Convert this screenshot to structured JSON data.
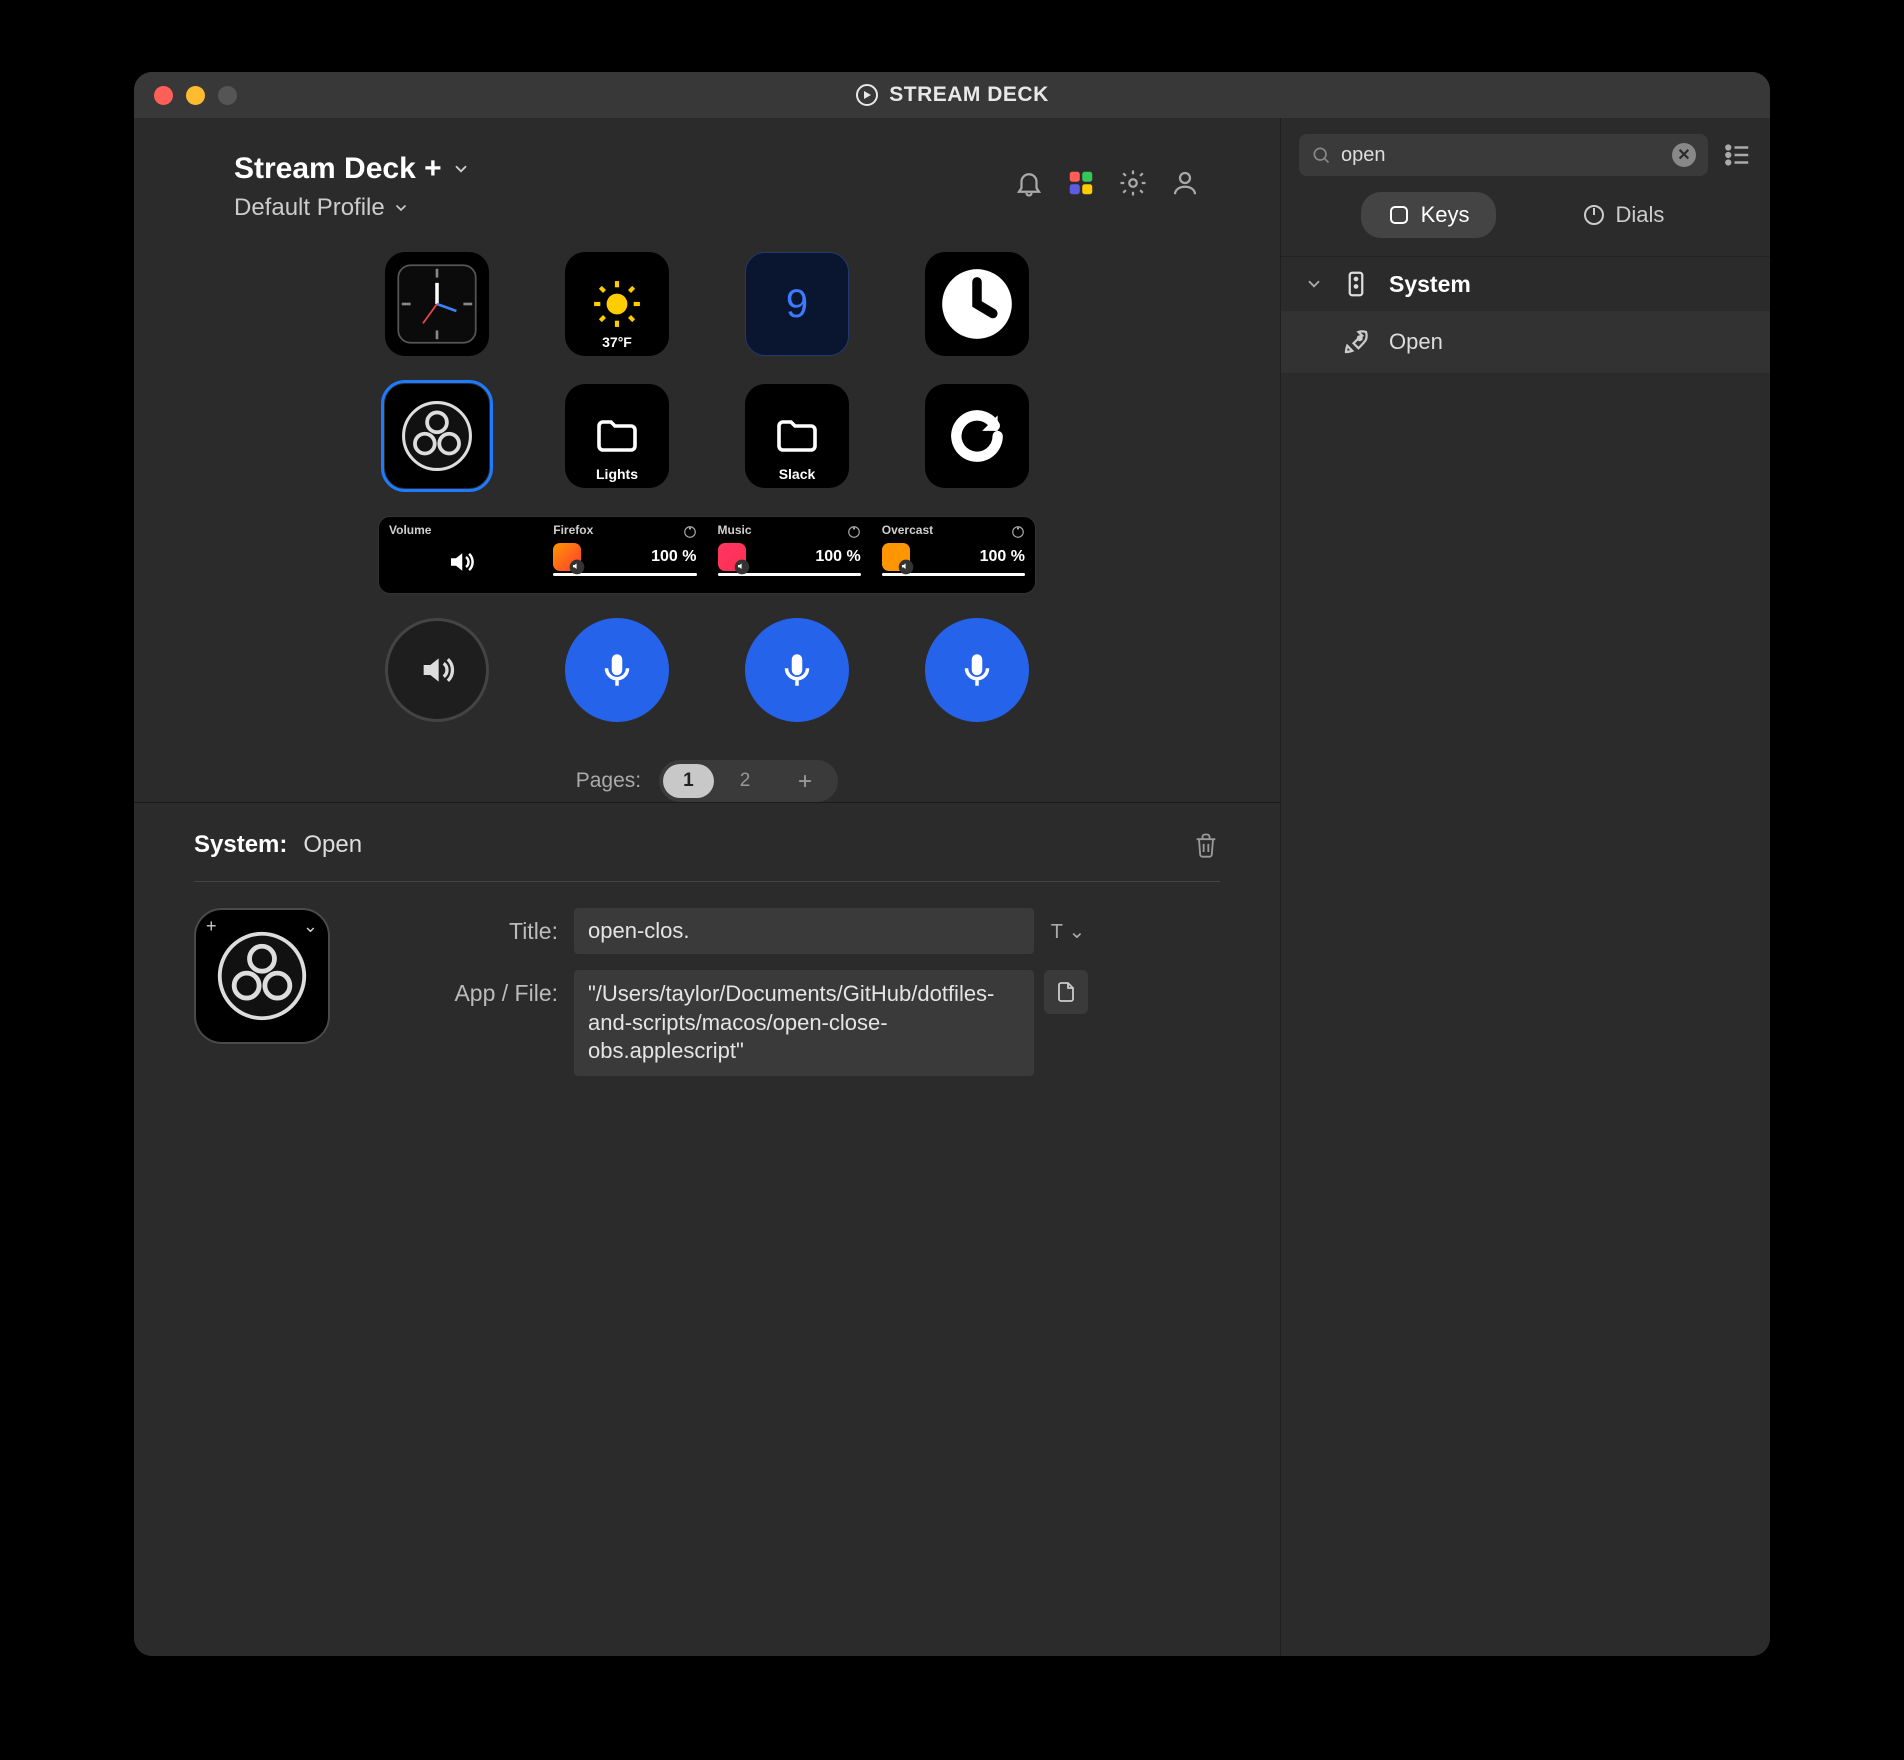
{
  "window": {
    "title": "STREAM DECK"
  },
  "header": {
    "device_name": "Stream Deck +",
    "profile_name": "Default Profile"
  },
  "keys": {
    "row1": [
      {
        "kind": "clock-analog"
      },
      {
        "kind": "weather",
        "temp": "37°F"
      },
      {
        "kind": "number",
        "value": "9"
      },
      {
        "kind": "clock-white"
      }
    ],
    "row2": [
      {
        "kind": "obs",
        "selected": true
      },
      {
        "kind": "folder",
        "label": "Lights"
      },
      {
        "kind": "folder",
        "label": "Slack"
      },
      {
        "kind": "reload"
      }
    ]
  },
  "touch": [
    {
      "title": "Volume",
      "kind": "volume"
    },
    {
      "title": "Firefox",
      "value": "100 %",
      "color": "#ff7a18",
      "fill": 100
    },
    {
      "title": "Music",
      "value": "100 %",
      "color": "#ff3b5b",
      "fill": 100
    },
    {
      "title": "Overcast",
      "value": "100 %",
      "color": "#ff9500",
      "fill": 100
    }
  ],
  "dials": [
    {
      "kind": "volume"
    },
    {
      "kind": "mic"
    },
    {
      "kind": "mic"
    },
    {
      "kind": "mic"
    }
  ],
  "pager": {
    "label": "Pages:",
    "pages": [
      "1",
      "2"
    ],
    "active": 0
  },
  "inspector": {
    "category": "System:",
    "action": "Open",
    "title_label": "Title:",
    "title_value": "open-clos.",
    "file_label": "App / File:",
    "file_value": "\"/Users/taylor/Documents/GitHub/dotfiles-and-scripts/macos/open-close-obs.applescript\""
  },
  "sidebar": {
    "search": {
      "value": "open",
      "placeholder": "Search"
    },
    "tabs": {
      "keys": "Keys",
      "dials": "Dials",
      "active": "keys"
    },
    "group": {
      "name": "System"
    },
    "items": [
      {
        "name": "Open"
      }
    ]
  }
}
